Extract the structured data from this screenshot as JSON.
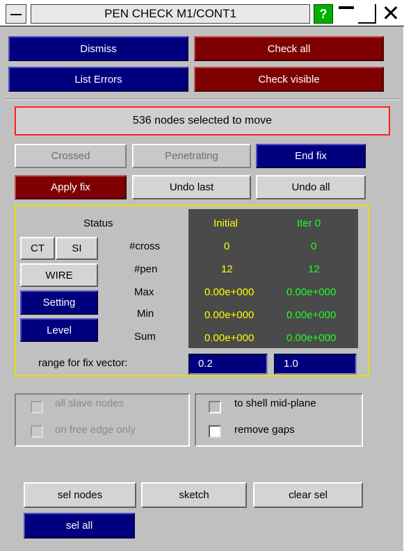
{
  "titlebar": {
    "title": "PEN CHECK M1/CONT1",
    "help_label": "?"
  },
  "buttons": {
    "dismiss": "Dismiss",
    "check_all": "Check all",
    "list_errors": "List Errors",
    "check_visible": "Check visible"
  },
  "message": "536 nodes selected to move",
  "fix": {
    "crossed": "Crossed",
    "penetrating": "Penetrating",
    "end_fix": "End fix",
    "apply_fix": "Apply fix",
    "undo_last": "Undo last",
    "undo_all": "Undo all"
  },
  "status": {
    "heading": "Status",
    "ct": "CT",
    "si": "SI",
    "wire": "WIRE",
    "setting": "Setting",
    "level": "Level",
    "row_labels": [
      "#cross",
      "#pen",
      "Max",
      "Min",
      "Sum"
    ],
    "col_initial": "Initial",
    "col_iter": "Iter 0",
    "initial_values": [
      "0",
      "12",
      "0.00e+000",
      "0.00e+000",
      "0.00e+000"
    ],
    "iter_values": [
      "0",
      "12",
      "0.00e+000",
      "0.00e+000",
      "0.00e+000"
    ],
    "range_label": "range for fix vector:",
    "range_min": "0.2",
    "range_max": "1.0",
    "colors": {
      "initial": "#ffff00",
      "iter": "#20ff20"
    }
  },
  "options": {
    "all_slave_nodes": "all slave nodes",
    "on_free_edge_only": "on free edge only",
    "to_shell_mid_plane": "to shell mid-plane",
    "remove_gaps": "remove gaps"
  },
  "selection": {
    "sel_nodes": "sel nodes",
    "sketch": "sketch",
    "clear_sel": "clear sel",
    "sel_all": "sel all"
  }
}
